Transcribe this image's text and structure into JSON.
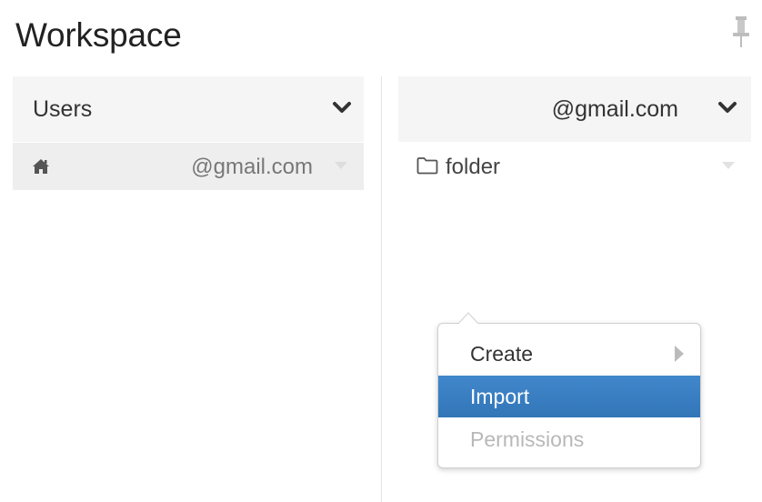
{
  "header": {
    "title": "Workspace",
    "pin_icon": "pin-icon"
  },
  "left_column": {
    "header_label": "Users",
    "chevron_icon": "chevron-down-icon",
    "rows": [
      {
        "icon": "home-icon",
        "email": "@gmail.com",
        "caret_icon": "caret-down-icon"
      }
    ]
  },
  "right_column": {
    "header_label": "@gmail.com",
    "chevron_icon": "chevron-down-icon",
    "rows": [
      {
        "icon": "folder-icon",
        "label": "folder",
        "caret_icon": "caret-down-icon"
      }
    ]
  },
  "context_menu": {
    "items": [
      {
        "label": "Create",
        "state": "normal",
        "has_submenu": true
      },
      {
        "label": "Import",
        "state": "highlighted"
      },
      {
        "label": "Permissions",
        "state": "disabled"
      }
    ]
  },
  "colors": {
    "highlight": "#3a7fc2",
    "header_bg": "#f5f5f5",
    "selected_row_bg": "#eeeeee",
    "disabled_text": "#b8b8b8"
  }
}
